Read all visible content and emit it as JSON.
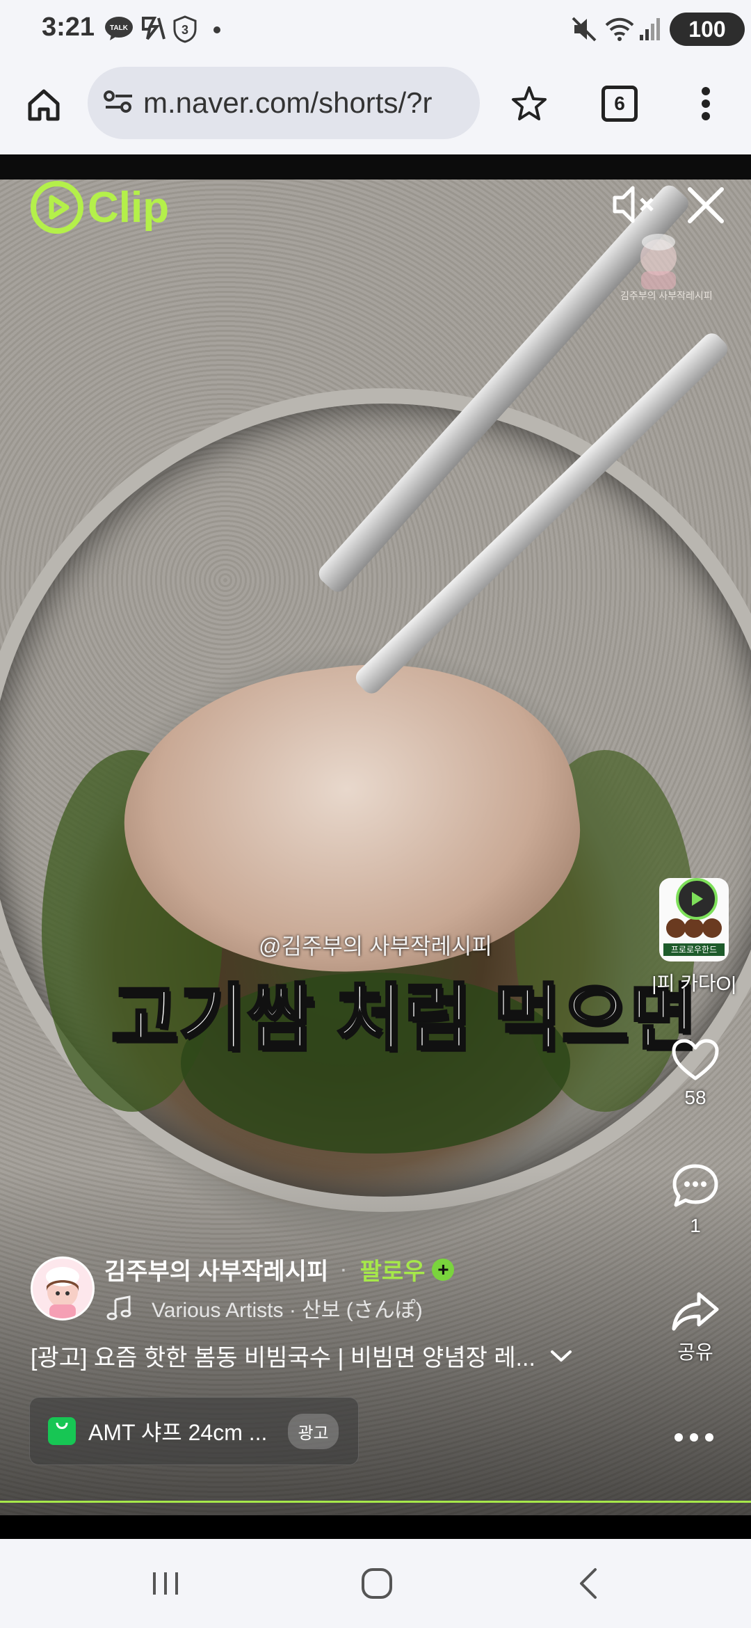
{
  "status_bar": {
    "time": "3:21",
    "talk_label": "TALK",
    "shield_number": "3",
    "battery": "100"
  },
  "browser": {
    "url": "m.naver.com/shorts/?r",
    "tab_count": "6"
  },
  "video": {
    "app_logo_text": "Clip",
    "watermark_text": "김주부의 사부작레시피",
    "credit_overlay": "@김주부의 사부작레시피",
    "caption": "고기쌈 처럼 먹으면"
  },
  "rail": {
    "ad_name": "|피 카다O|",
    "ad_thumb_label": "프로로우한드",
    "like_count": "58",
    "comment_count": "1",
    "share_label": "공유"
  },
  "info": {
    "channel_name": "김주부의 사부작레시피",
    "separator": "·",
    "follow_label": "팔로우",
    "music": "Various Artists · 산보 (さんぽ)",
    "title": "[광고] 요즘 핫한 봄동 비빔국수 | 비빔면 양념장 레...",
    "product_name": "AMT 샤프 24cm ...",
    "ad_badge": "광고"
  },
  "colors": {
    "accent_green": "#a6e84a",
    "shop_green": "#17c654"
  }
}
